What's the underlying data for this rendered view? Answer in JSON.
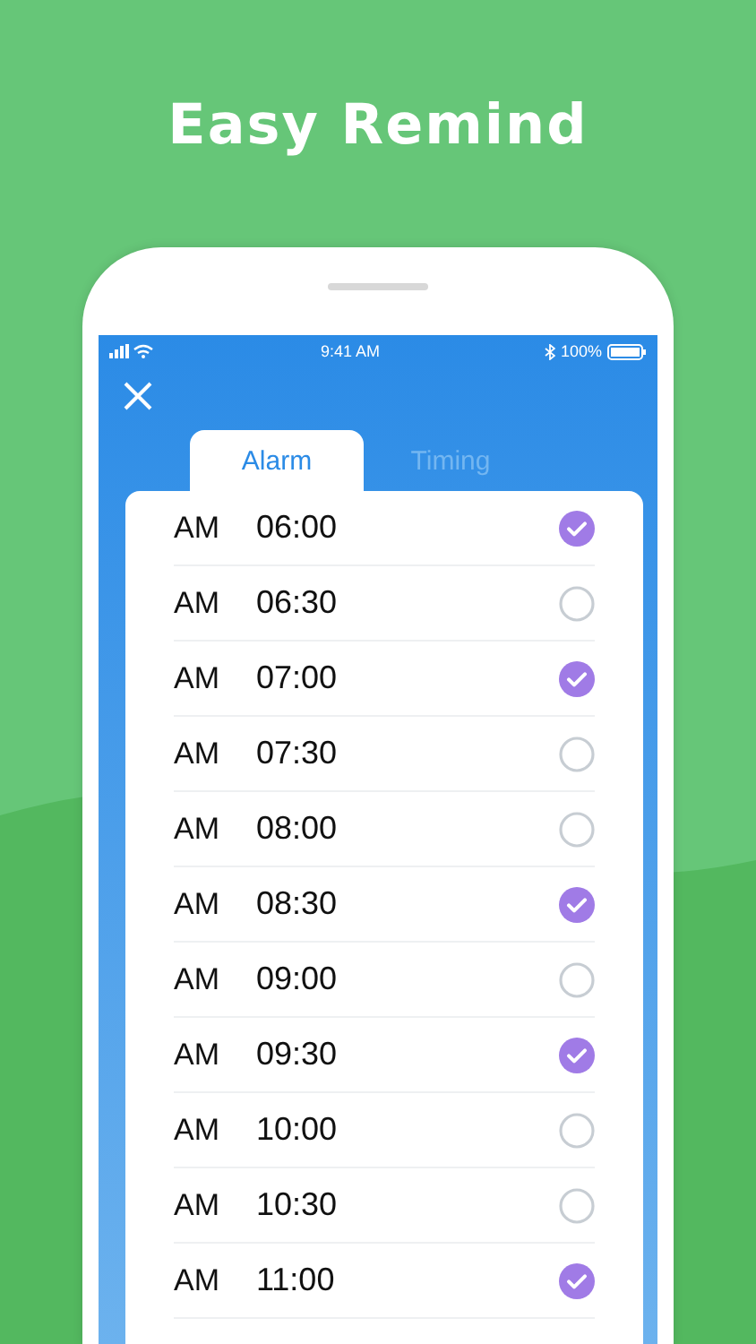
{
  "headline": "Easy Remind",
  "status_bar": {
    "time": "9:41 AM",
    "battery": "100%"
  },
  "tabs": [
    {
      "label": "Alarm",
      "selected": true
    },
    {
      "label": "Timing",
      "selected": false
    }
  ],
  "alarms": [
    {
      "period": "AM",
      "time": "06:00",
      "checked": true
    },
    {
      "period": "AM",
      "time": "06:30",
      "checked": false
    },
    {
      "period": "AM",
      "time": "07:00",
      "checked": true
    },
    {
      "period": "AM",
      "time": "07:30",
      "checked": false
    },
    {
      "period": "AM",
      "time": "08:00",
      "checked": false
    },
    {
      "period": "AM",
      "time": "08:30",
      "checked": true
    },
    {
      "period": "AM",
      "time": "09:00",
      "checked": false
    },
    {
      "period": "AM",
      "time": "09:30",
      "checked": true
    },
    {
      "period": "AM",
      "time": "10:00",
      "checked": false
    },
    {
      "period": "AM",
      "time": "10:30",
      "checked": false
    },
    {
      "period": "AM",
      "time": "11:00",
      "checked": true
    }
  ]
}
